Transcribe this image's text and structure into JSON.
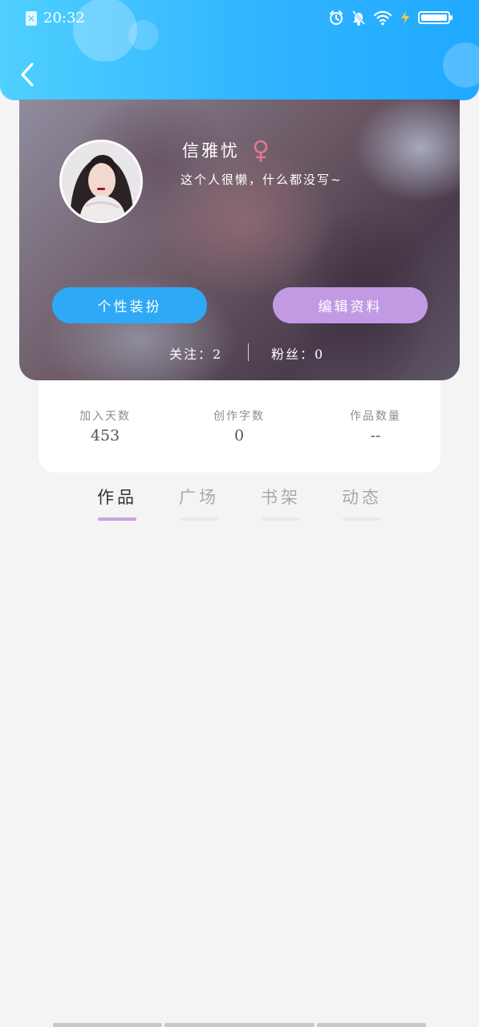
{
  "status_bar": {
    "time": "20:32",
    "sim_icon": "sim-error-icon",
    "icons": [
      "alarm-icon",
      "mute-bell-icon",
      "wifi-icon",
      "charging-icon",
      "battery-icon"
    ]
  },
  "header": {
    "back_icon": "chevron-left-icon"
  },
  "profile": {
    "username": "信雅忧",
    "gender_icon": "female-icon",
    "gender_color": "#e07a92",
    "bio": "这个人很懒，什么都没写~",
    "style_button_label": "个性装扮",
    "edit_button_label": "编辑资料",
    "following_text": "关注：2",
    "fans_text": "粉丝：0",
    "style_button_color": "#2ea9f5",
    "edit_button_color": "#c29ae4"
  },
  "stats": [
    {
      "label": "加入天数",
      "value": "453"
    },
    {
      "label": "创作字数",
      "value": "0"
    },
    {
      "label": "作品数量",
      "value": "--"
    }
  ],
  "tabs": [
    {
      "label": "作品",
      "active": true
    },
    {
      "label": "广场",
      "active": false
    },
    {
      "label": "书架",
      "active": false
    },
    {
      "label": "动态",
      "active": false
    }
  ],
  "colors": {
    "header_gradient_start": "#4fd0ff",
    "header_gradient_end": "#1fa9ff",
    "tab_active_underline": "#c9a2e6",
    "page_background": "#f4f4f4"
  }
}
